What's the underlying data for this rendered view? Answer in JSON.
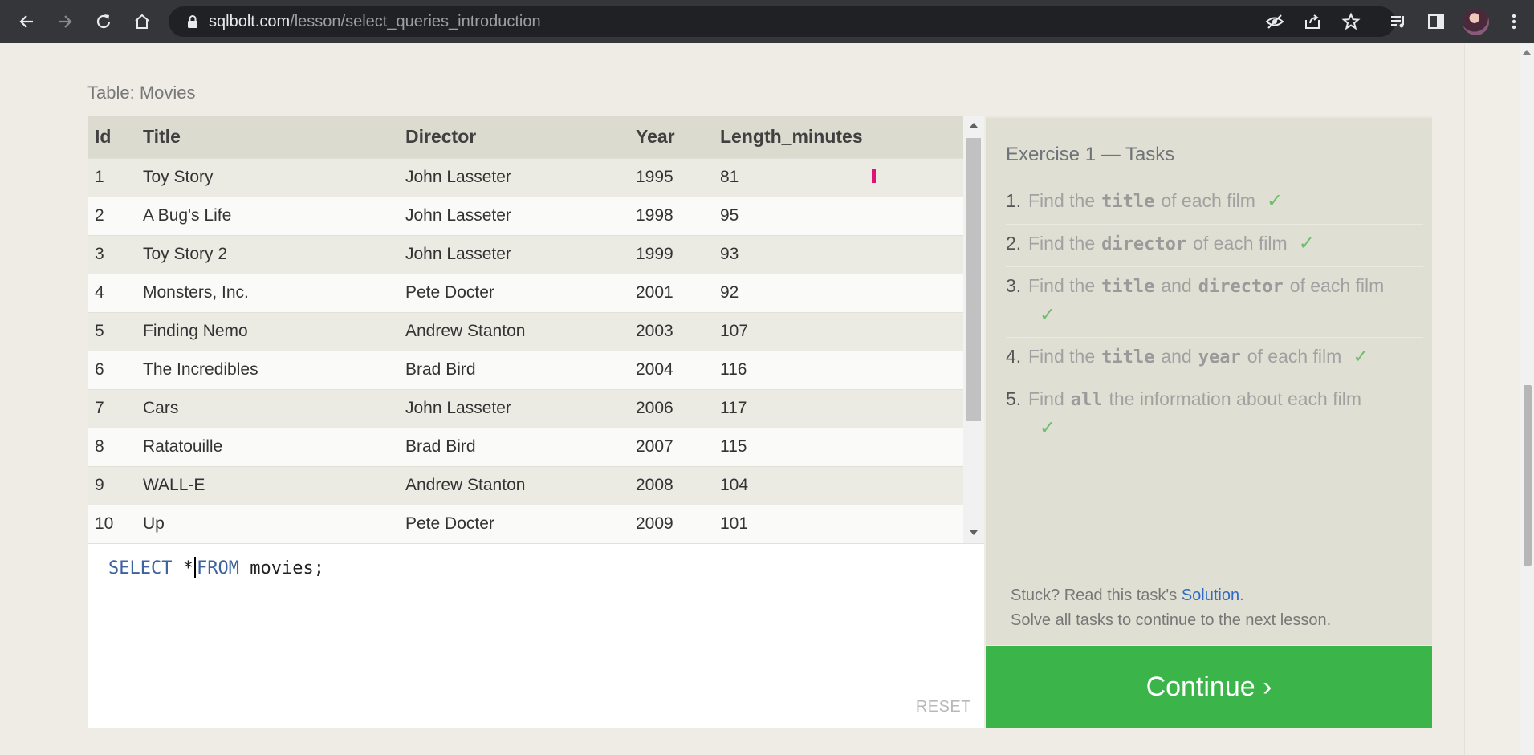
{
  "browser": {
    "url_host": "sqlbolt.com",
    "url_path": "/lesson/select_queries_introduction",
    "icons": [
      "back-icon",
      "forward-icon",
      "reload-icon",
      "home-icon",
      "lock-icon",
      "eye-off-icon",
      "share-icon",
      "star-icon",
      "media-icon",
      "sidepanel-icon",
      "profile-avatar",
      "menu-icon"
    ]
  },
  "lesson": {
    "table_caption": "Table: Movies",
    "table": {
      "headers": [
        "Id",
        "Title",
        "Director",
        "Year",
        "Length_minutes"
      ],
      "rows": [
        [
          "1",
          "Toy Story",
          "John Lasseter",
          "1995",
          "81"
        ],
        [
          "2",
          "A Bug's Life",
          "John Lasseter",
          "1998",
          "95"
        ],
        [
          "3",
          "Toy Story 2",
          "John Lasseter",
          "1999",
          "93"
        ],
        [
          "4",
          "Monsters, Inc.",
          "Pete Docter",
          "2001",
          "92"
        ],
        [
          "5",
          "Finding Nemo",
          "Andrew Stanton",
          "2003",
          "107"
        ],
        [
          "6",
          "The Incredibles",
          "Brad Bird",
          "2004",
          "116"
        ],
        [
          "7",
          "Cars",
          "John Lasseter",
          "2006",
          "117"
        ],
        [
          "8",
          "Ratatouille",
          "Brad Bird",
          "2007",
          "115"
        ],
        [
          "9",
          "WALL-E",
          "Andrew Stanton",
          "2008",
          "104"
        ],
        [
          "10",
          "Up",
          "Pete Docter",
          "2009",
          "101"
        ]
      ]
    },
    "editor": {
      "kw_select": "SELECT",
      "star": "*",
      "kw_from": "FROM",
      "rest": "movies;",
      "reset_label": "RESET"
    },
    "tasks": {
      "title": "Exercise 1 — Tasks",
      "items": [
        {
          "num": "1.",
          "pre": "Find the",
          "code1": "title",
          "mid": "",
          "code2": "",
          "post": "of each film",
          "check": "✓"
        },
        {
          "num": "2.",
          "pre": "Find the",
          "code1": "director",
          "mid": "",
          "code2": "",
          "post": "of each film",
          "check": "✓"
        },
        {
          "num": "3.",
          "pre": "Find the",
          "code1": "title",
          "mid": "and",
          "code2": "director",
          "post": "of each film",
          "check": "✓"
        },
        {
          "num": "4.",
          "pre": "Find the",
          "code1": "title",
          "mid": "and",
          "code2": "year",
          "post": "of each film",
          "check": "✓"
        },
        {
          "num": "5.",
          "pre": "Find",
          "code1": "all",
          "mid": "",
          "code2": "",
          "post": "the information about each film",
          "check": "✓"
        }
      ],
      "stuck_pre": "Stuck? Read this task's",
      "stuck_link": "Solution",
      "stuck_post": ".",
      "solve_text": "Solve all tasks to continue to the next lesson."
    },
    "continue_label": "Continue ›"
  },
  "colors": {
    "continue_bg": "#3bb54a",
    "check": "#6fbe6f",
    "sql_keyword": "#3c62a0",
    "link": "#2f6ac4"
  }
}
